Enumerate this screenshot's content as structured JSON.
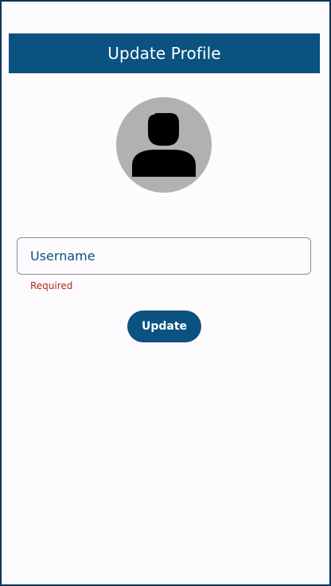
{
  "header": {
    "title": "Update Profile"
  },
  "avatar": {
    "icon": "person-icon"
  },
  "form": {
    "username_placeholder": "Username",
    "username_value": "",
    "error_text": "Required",
    "update_label": "Update"
  },
  "colors": {
    "primary": "#0b5280",
    "background": "#fdfbfd",
    "avatar_bg": "#b1b1b1",
    "error": "#b3261e"
  }
}
